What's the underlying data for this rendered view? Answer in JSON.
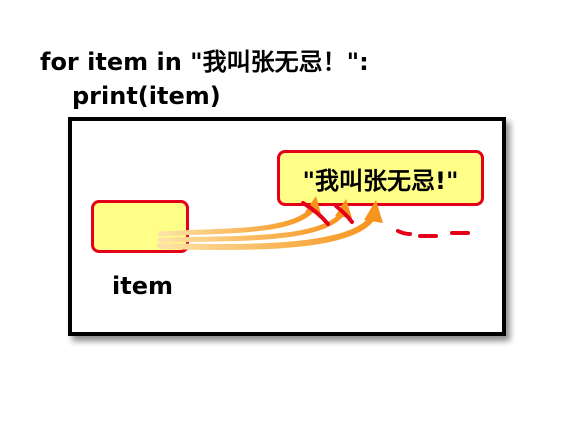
{
  "code": {
    "line1": "for item in \"我叫张无忌！\":",
    "line2": "print(item)"
  },
  "diagram": {
    "string_value": "\"我叫张无忌!\"",
    "variable_label": "item",
    "colors": {
      "box_fill": "#ffff88",
      "box_border": "#e5001a",
      "arrow": "#f7941d",
      "dash": "#e5001a"
    }
  }
}
